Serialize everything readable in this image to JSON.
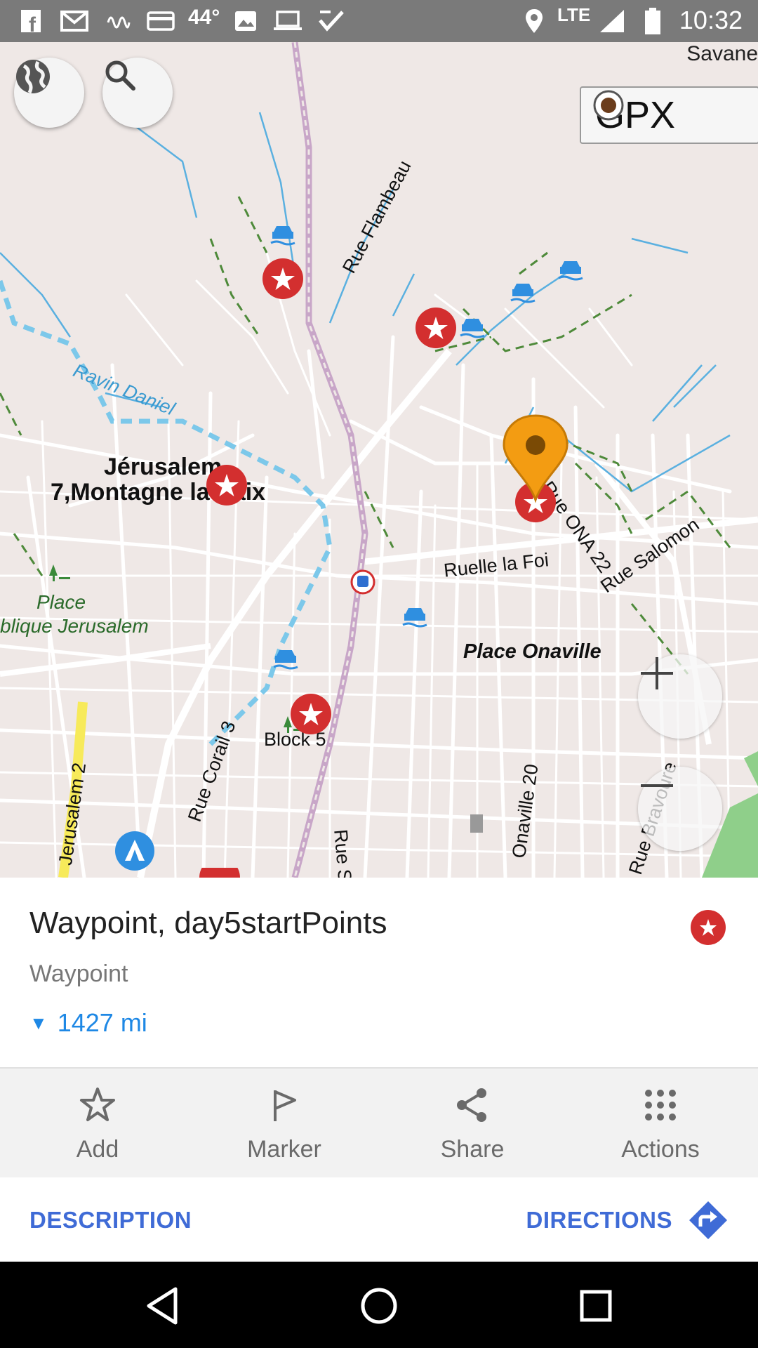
{
  "status_bar": {
    "temperature": "44°",
    "network": "LTE",
    "time": "10:32",
    "icons": [
      "facebook-icon",
      "gmail-icon",
      "voicemail-icon",
      "card-icon",
      "image-icon",
      "laptop-icon",
      "check-icon",
      "location-icon",
      "signal-icon",
      "battery-icon"
    ]
  },
  "map": {
    "corner_label": "Savane",
    "gpx_label": "GPX",
    "labels": {
      "rue_flambeau": "Rue Flambeau",
      "ravine": "Ravin Daniel",
      "jerusalem": "Jérusalem",
      "montagne": "7,Montagne la Paix",
      "place_jer_1": "Place",
      "place_jer_2": "blique Jerusalem",
      "ruelle_foi": "Ruelle la Foi",
      "rue_salomon": "Rue Salomon",
      "rue_ona": "Rue ONA 22",
      "place_onaville": "Place Onaville",
      "block5": "Block 5",
      "rue_corail": "Rue Corail 3",
      "jerusalem2": "Jerusalem 2",
      "onaville20": "Onaville 20",
      "rue_bravoure": "Rue Bravoure",
      "rue_s": "Rue S"
    }
  },
  "waypoint": {
    "title": "Waypoint, day5startPoints",
    "type": "Waypoint",
    "distance": "1427 mi",
    "accent": "#d32f2f"
  },
  "actions": [
    {
      "label": "Add",
      "icon": "star-icon"
    },
    {
      "label": "Marker",
      "icon": "flag-icon"
    },
    {
      "label": "Share",
      "icon": "share-icon"
    },
    {
      "label": "Actions",
      "icon": "grid-icon"
    }
  ],
  "links": {
    "description": "DESCRIPTION",
    "directions": "DIRECTIONS"
  },
  "colors": {
    "link_blue": "#3f6bd6",
    "distance_blue": "#1e88e5",
    "marker_orange": "#f39c12"
  }
}
